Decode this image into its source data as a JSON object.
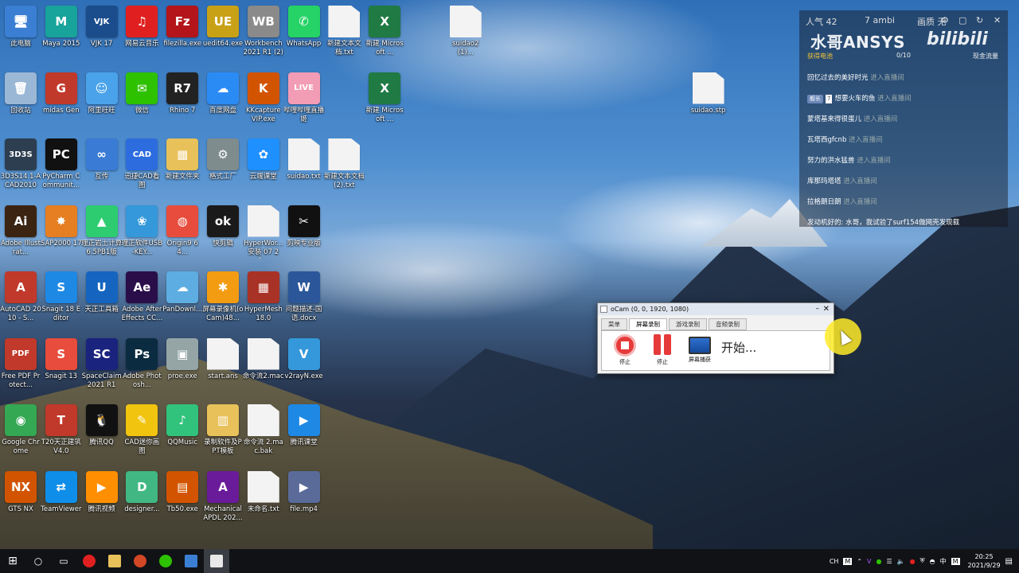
{
  "desktop_icons": [
    {
      "label": "此电脑",
      "glyph": "🖥",
      "color": "#3b7fd4"
    },
    {
      "label": "Maya 2015",
      "glyph": "M",
      "color": "#18a39b"
    },
    {
      "label": "VJK 17",
      "glyph": "VJK",
      "color": "#1b4d8c"
    },
    {
      "label": "网易云音乐",
      "glyph": "♫",
      "color": "#e02020"
    },
    {
      "label": "filezilla.exe",
      "glyph": "Fz",
      "color": "#b3151a"
    },
    {
      "label": "uedit64.exe",
      "glyph": "UE",
      "color": "#c8a116"
    },
    {
      "label": "Workbench 2021 R1 (2)",
      "glyph": "WB",
      "color": "#8a8a8a"
    },
    {
      "label": "WhatsApp",
      "glyph": "✆",
      "color": "#25d366"
    },
    {
      "label": "新建文本文档.txt",
      "glyph": "",
      "color": "#f3f3f3"
    },
    {
      "label": "新建 Microsoft ...",
      "glyph": "X",
      "color": "#1f7a44"
    },
    {
      "label": "suidao2(1)...",
      "glyph": "",
      "color": "#f3f3f3"
    },
    {
      "label": "回收站",
      "glyph": "🗑",
      "color": "#9bb7d6"
    },
    {
      "label": "midas Gen",
      "glyph": "G",
      "color": "#c0392b"
    },
    {
      "label": "阿里旺旺",
      "glyph": "☺",
      "color": "#4aa3ea"
    },
    {
      "label": "微信",
      "glyph": "✉",
      "color": "#2dc100"
    },
    {
      "label": "Rhino 7",
      "glyph": "R7",
      "color": "#222"
    },
    {
      "label": "百度网盘",
      "glyph": "☁",
      "color": "#2b8bf5"
    },
    {
      "label": "KKcapture VIP.exe",
      "glyph": "K",
      "color": "#d35400"
    },
    {
      "label": "哔哩哔哩直播姬",
      "glyph": "LIVE",
      "color": "#f39cb5"
    },
    {
      "label": "新建 Microsoft ...",
      "glyph": "X",
      "color": "#1f7a44"
    },
    {
      "label": "suidao.stp",
      "glyph": "",
      "color": "#f3f3f3"
    },
    {
      "label": "3D3S14.1-ACAD2010",
      "glyph": "3D3S",
      "color": "#2c3e50"
    },
    {
      "label": "PyCharm Communit...",
      "glyph": "PC",
      "color": "#111"
    },
    {
      "label": "互传",
      "glyph": "∞",
      "color": "#3a7bd5"
    },
    {
      "label": "迅捷CAD看图",
      "glyph": "CAD",
      "color": "#2d6cdf"
    },
    {
      "label": "新建文件夹",
      "glyph": "▦",
      "color": "#e8c15a"
    },
    {
      "label": "格式工厂",
      "glyph": "⚙",
      "color": "#7f8c8d"
    },
    {
      "label": "云端课堂",
      "glyph": "✿",
      "color": "#1e90ff"
    },
    {
      "label": "suidao.txt",
      "glyph": "",
      "color": "#f3f3f3"
    },
    {
      "label": "新建文本文档(2).txt",
      "glyph": "",
      "color": "#f3f3f3"
    },
    {
      "label": "Adobe Illustrat...",
      "glyph": "Ai",
      "color": "#3b2412"
    },
    {
      "label": "SAP2000 17",
      "glyph": "✸",
      "color": "#e67e22"
    },
    {
      "label": "理正岩土计算6.5PB1版",
      "glyph": "▲",
      "color": "#2ecc71"
    },
    {
      "label": "理正软件USB-KEY...",
      "glyph": "❀",
      "color": "#3498db"
    },
    {
      "label": "Origin9 64...",
      "glyph": "◍",
      "color": "#e74c3c"
    },
    {
      "label": "快剪辑",
      "glyph": "ok",
      "color": "#1a1a1a"
    },
    {
      "label": "HyperWor... 安装 07 22...",
      "glyph": "",
      "color": "#f3f3f3"
    },
    {
      "label": "剪映专业版",
      "glyph": "✂",
      "color": "#111"
    },
    {
      "label": "AutoCAD 2010 - S...",
      "glyph": "A",
      "color": "#c0392b"
    },
    {
      "label": "Snagit 18 Editor",
      "glyph": "S",
      "color": "#1e88e5"
    },
    {
      "label": "天正工具箱",
      "glyph": "U",
      "color": "#1565c0"
    },
    {
      "label": "Adobe After Effects CC...",
      "glyph": "Ae",
      "color": "#2a0e4a"
    },
    {
      "label": "PanDownl...",
      "glyph": "☁",
      "color": "#5dade2"
    },
    {
      "label": "屏幕录像机(oCam)48...",
      "glyph": "✱",
      "color": "#f39c12"
    },
    {
      "label": "HyperMesh 18.0",
      "glyph": "▦",
      "color": "#a93226"
    },
    {
      "label": "问题描述-国语.docx",
      "glyph": "W",
      "color": "#2b579a"
    },
    {
      "label": "Free PDF Protect...",
      "glyph": "PDF",
      "color": "#c0392b"
    },
    {
      "label": "Snagit 13",
      "glyph": "S",
      "color": "#e74c3c"
    },
    {
      "label": "SpaceClaim 2021 R1",
      "glyph": "SC",
      "color": "#1a237e"
    },
    {
      "label": "Adobe Photosh...",
      "glyph": "Ps",
      "color": "#0b2b40"
    },
    {
      "label": "proe.exe",
      "glyph": "▣",
      "color": "#95a5a6"
    },
    {
      "label": "start.ans",
      "glyph": "",
      "color": "#f3f3f3"
    },
    {
      "label": "命令流2.mac",
      "glyph": "",
      "color": "#f3f3f3"
    },
    {
      "label": "v2rayN.exe",
      "glyph": "V",
      "color": "#3498db"
    },
    {
      "label": "Google Chrome",
      "glyph": "◉",
      "color": "#34a853"
    },
    {
      "label": "T20天正建筑 V4.0",
      "glyph": "T",
      "color": "#c0392b"
    },
    {
      "label": "腾讯QQ",
      "glyph": "🐧",
      "color": "#111"
    },
    {
      "label": "CAD迷你画图",
      "glyph": "✎",
      "color": "#f1c40f"
    },
    {
      "label": "QQMusic",
      "glyph": "♪",
      "color": "#31c27c"
    },
    {
      "label": "录制软件及PPT模板",
      "glyph": "▥",
      "color": "#e8c15a"
    },
    {
      "label": "命令流 2.mac.bak",
      "glyph": "",
      "color": "#f3f3f3"
    },
    {
      "label": "腾讯课堂",
      "glyph": "▶",
      "color": "#1e88e5"
    },
    {
      "label": "GTS NX",
      "glyph": "NX",
      "color": "#d35400"
    },
    {
      "label": "TeamViewer",
      "glyph": "⇄",
      "color": "#0e8ee9"
    },
    {
      "label": "腾讯视频",
      "glyph": "▶",
      "color": "#ff8f00"
    },
    {
      "label": "designer...",
      "glyph": "D",
      "color": "#41b883"
    },
    {
      "label": "Tb50.exe",
      "glyph": "▤",
      "color": "#d35400"
    },
    {
      "label": "Mechanical APDL 202...",
      "glyph": "A",
      "color": "#6a1b9a"
    },
    {
      "label": "未命名.txt",
      "glyph": "",
      "color": "#f3f3f3"
    },
    {
      "label": "file.mp4",
      "glyph": "▶",
      "color": "#5a6b9a"
    }
  ],
  "bilibili": {
    "watermark": "水哥ANSYS",
    "logo": "bilibili",
    "top_left": "人气 42",
    "top_mid": "7 ambi",
    "top_right": "画质 无",
    "rank_label": "获得电池",
    "rank_count": "0/10",
    "cash_label": "现金流量",
    "messages": [
      {
        "user": "",
        "text": "回忆过去的美好时光",
        "action": "进入直播间"
      },
      {
        "user": "舰长",
        "level": "7",
        "text": "想要火车的鱼",
        "action": "进入直播间"
      },
      {
        "user": "",
        "text": "蒙塔基来得很蛋儿",
        "action": "进入直播间"
      },
      {
        "user": "",
        "text": "瓦塔西gfcnb",
        "action": "进入直播间"
      },
      {
        "user": "",
        "text": "努力的洪水猛兽",
        "action": "进入直播间"
      },
      {
        "user": "",
        "text": "库那玛塔塔",
        "action": "进入直播间"
      },
      {
        "user": "",
        "text": "拉格朗日朗",
        "action": "进入直播间"
      },
      {
        "user": "",
        "text": "发动机好的: 水哥，我试验了surf154做网壳发现载",
        "action": ""
      }
    ]
  },
  "ocam": {
    "title": "oCam (0, 0, 1920, 1080)",
    "tabs": [
      "菜单",
      "屏幕录制",
      "游戏录制",
      "音频录制"
    ],
    "active_tab": 1,
    "buttons": {
      "stop": "停止",
      "pause": "停止",
      "capture": "屏幕捕获"
    },
    "status": "开始..."
  },
  "taskbar": {
    "tray_ime": "CH",
    "tray_lang": "中",
    "time": "20:25",
    "date": "2021/9/29"
  }
}
